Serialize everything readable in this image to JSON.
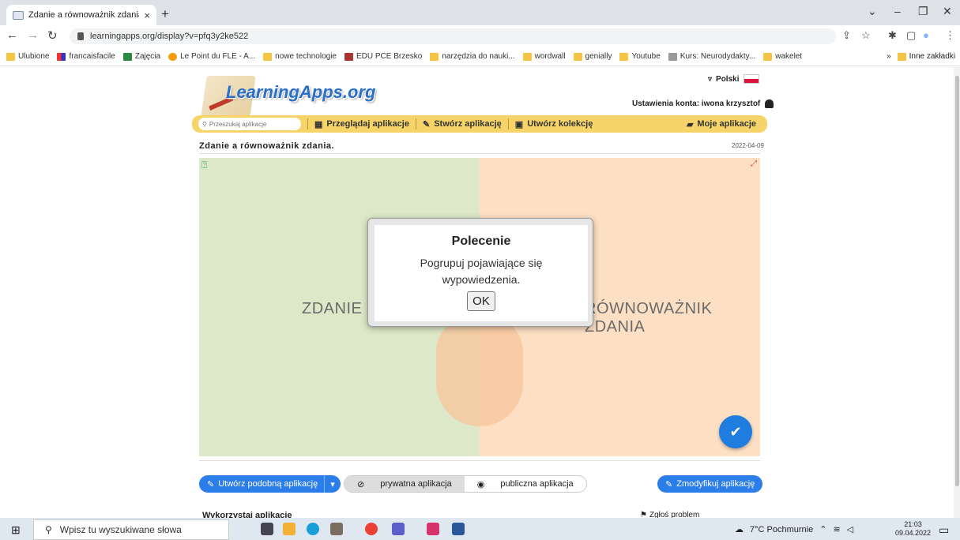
{
  "browser": {
    "tab_title": "Zdanie a równoważnik zdania.",
    "tab_close": "×",
    "new_tab": "+",
    "url": "learningapps.org/display?v=pfq3y2ke522",
    "bookmarks": [
      {
        "label": "Ulubione",
        "icon": "folder-icon"
      },
      {
        "label": "francaisfacile",
        "icon": "colorful-icon"
      },
      {
        "label": "Zajęcia",
        "icon": "classroom-icon"
      },
      {
        "label": "Le Point du FLE - A...",
        "icon": "orange-dot-icon"
      },
      {
        "label": "nowe technologie",
        "icon": "folder-icon"
      },
      {
        "label": "EDU PCE Brzesko",
        "icon": "school-icon"
      },
      {
        "label": "narzędzia do nauki...",
        "icon": "folder-icon"
      },
      {
        "label": "wordwall",
        "icon": "folder-icon"
      },
      {
        "label": "genially",
        "icon": "folder-icon"
      },
      {
        "label": "Youtube",
        "icon": "folder-icon"
      },
      {
        "label": "Kurs: Neurodydakty...",
        "icon": "page-icon"
      },
      {
        "label": "wakelet",
        "icon": "folder-icon"
      }
    ],
    "bookmarks_more": "»",
    "other_bookmarks": "Inne zakładki"
  },
  "site": {
    "logo": "LearningApps.org",
    "language": "Polski",
    "account": "Ustawienia konta: iwona krzysztof",
    "search_placeholder": "Przeszukaj aplikacje",
    "menu": {
      "browse": "Przeglądaj aplikacje",
      "create": "Stwórz aplikację",
      "collection": "Utwórz kolekcję",
      "my_apps": "Moje aplikacje"
    }
  },
  "app": {
    "title": "Zdanie a równoważnik zdania.",
    "date": "2022-04-09",
    "left_label": "ZDANIE",
    "right_label": "RÓWNOWAŻNIK ZDANIA",
    "dialog": {
      "title": "Polecenie",
      "text": "Pogrupuj pojawiające się wypowiedzenia.",
      "ok": "OK"
    }
  },
  "actions": {
    "create_similar": "Utwórz podobną aplikację",
    "private": "prywatna aplikacja",
    "public": "publiczna aplikacja",
    "modify": "Zmodyfikuj aplikację",
    "use_title": "Wykorzystaj aplikację",
    "report": "Zgłoś problem"
  },
  "taskbar": {
    "search_placeholder": "Wpisz tu wyszukiwane słowa",
    "weather": "7°C Pochmurnie",
    "time": "21:03",
    "date": "09.04.2022"
  }
}
